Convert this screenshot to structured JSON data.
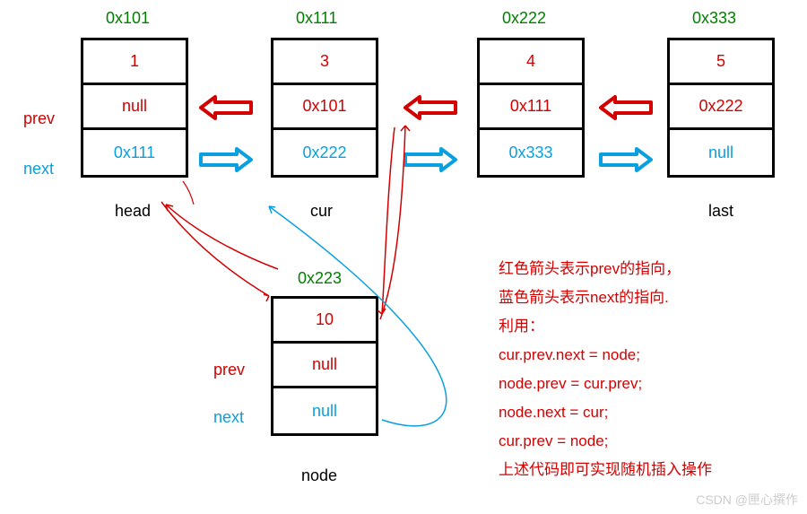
{
  "labels": {
    "prev": "prev",
    "next": "next",
    "head": "head",
    "cur": "cur",
    "last": "last",
    "node": "node"
  },
  "nodes": {
    "n1": {
      "addr": "0x101",
      "value": "1",
      "prev": "null",
      "next": "0x111"
    },
    "n2": {
      "addr": "0x111",
      "value": "3",
      "prev": "0x101",
      "next": "0x222"
    },
    "n3": {
      "addr": "0x222",
      "value": "4",
      "prev": "0x111",
      "next": "0x333"
    },
    "n4": {
      "addr": "0x333",
      "value": "5",
      "prev": "0x222",
      "next": "null"
    },
    "ins": {
      "addr": "0x223",
      "value": "10",
      "prev": "null",
      "next": "null"
    }
  },
  "desc": {
    "l1": "红色箭头表示prev的指向，",
    "l2": "蓝色箭头表示next的指向.",
    "l3": "利用：",
    "l4": "cur.prev.next = node;",
    "l5": "node.prev = cur.prev;",
    "l6": "node.next = cur;",
    "l7": "cur.prev = node;",
    "l8": "上述代码即可实现随机插入操作"
  },
  "watermark": "CSDN @匣心撰作"
}
